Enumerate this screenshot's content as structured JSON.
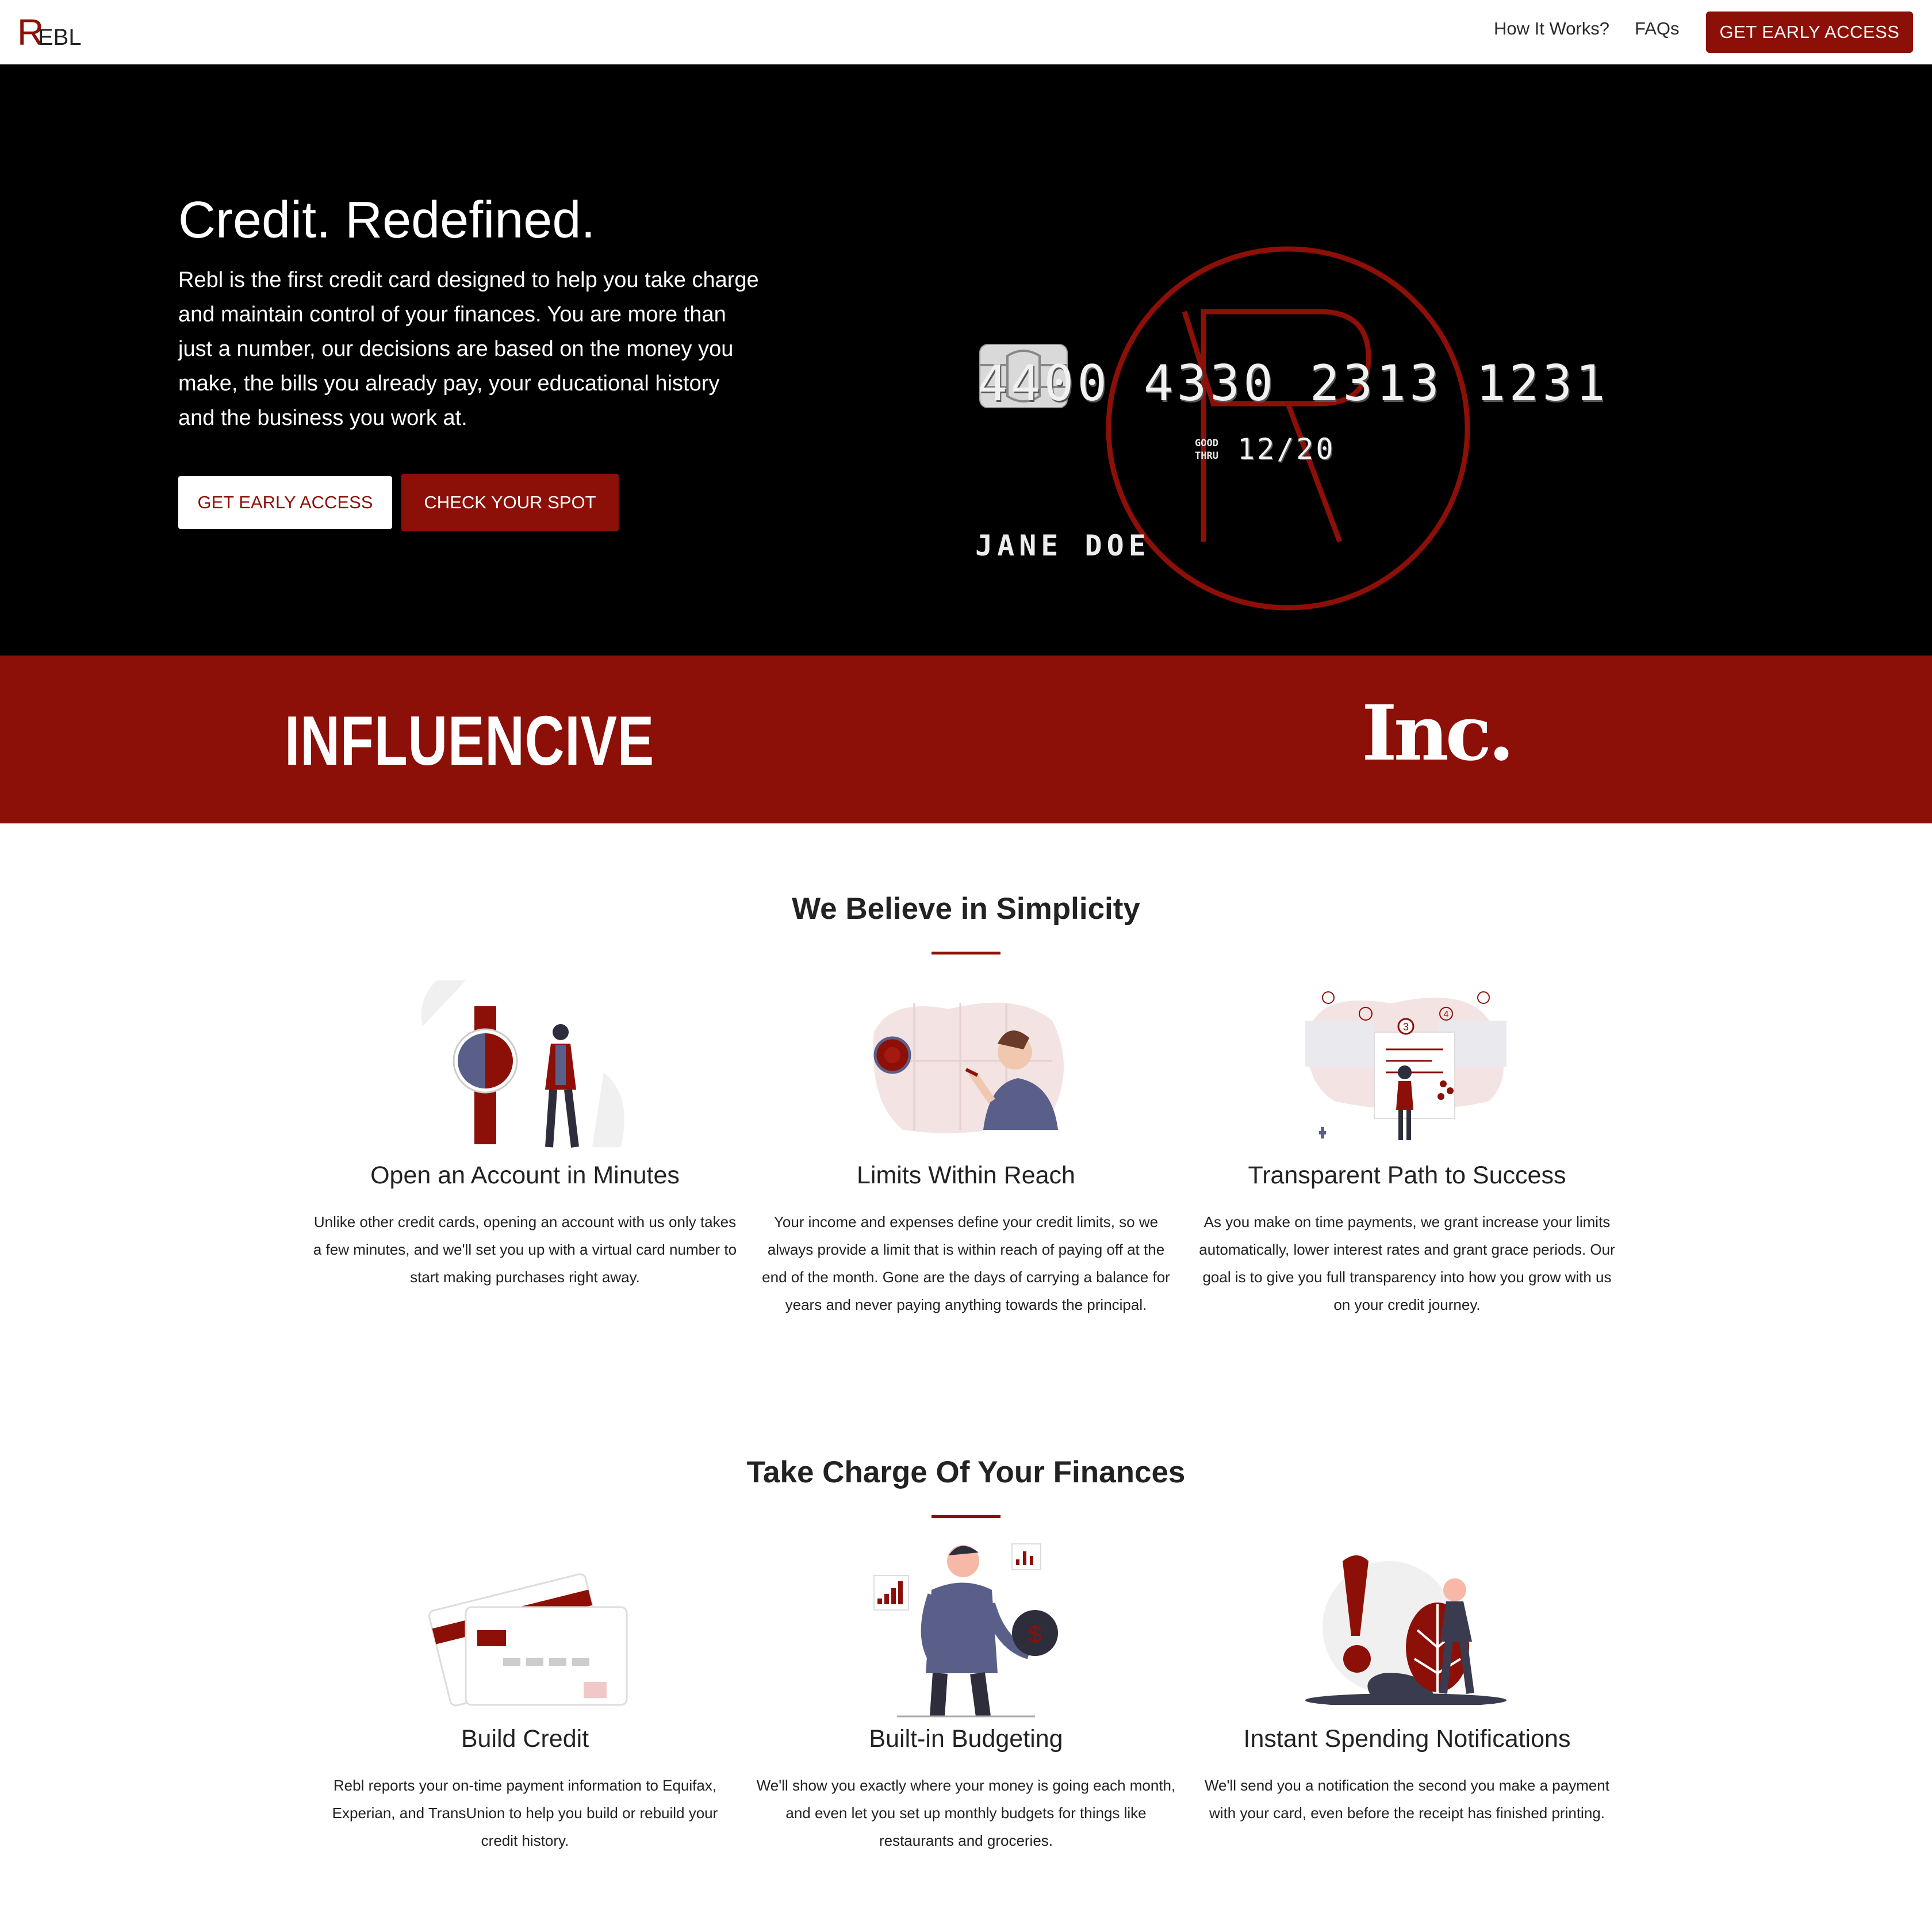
{
  "colors": {
    "accent": "#8c1007",
    "hero_bg": "#000000",
    "text": "#222222"
  },
  "nav": {
    "logo_letter": "R",
    "logo_text": "EBL",
    "links": [
      "How It Works?",
      "FAQs"
    ],
    "cta": "GET EARLY ACCESS"
  },
  "hero": {
    "title": "Credit. Redefined.",
    "text": "Rebl is the first credit card designed to help you take charge and maintain control of your finances. You are more than just a number, our decisions are based on the money you make, the bills you already pay, your educational history and the business you work at.",
    "primary_button": "GET EARLY ACCESS",
    "secondary_button": "CHECK YOUR SPOT",
    "card": {
      "number": "4400 4330 2313 1231",
      "good_thru_label_1": "GOOD",
      "good_thru_label_2": "THRU",
      "expiry": "12/20",
      "name": "JANE DOE"
    }
  },
  "press": [
    "INFLUENCIVE",
    "Inc."
  ],
  "simplicity": {
    "title": "We Believe in Simplicity",
    "features": [
      {
        "title": "Open an Account in Minutes",
        "text": "Unlike other credit cards, opening an account with us only takes a few minutes, and we'll set you up with a virtual card number to start making purchases right away.",
        "icon": "watch-person-illustration"
      },
      {
        "title": "Limits Within Reach",
        "text": "Your income and expenses define your credit limits, so we always provide a limit that is within reach of paying off at the end of the month. Gone are the days of carrying a balance for years and never paying anything towards the principal.",
        "icon": "dartboard-illustration"
      },
      {
        "title": "Transparent Path to Success",
        "text": "As you make on time payments, we grant increase your limits automatically, lower interest rates and grant grace periods. Our goal is to give you full transparency into how you grow with us on your credit journey.",
        "icon": "progress-steps-illustration",
        "steps": [
          "3",
          "4"
        ]
      }
    ]
  },
  "finances": {
    "title": "Take Charge Of Your Finances",
    "features": [
      {
        "title": "Build Credit",
        "text": "Rebl reports your on-time payment information to Equifax, Experian, and TransUnion to help you build or rebuild your credit history.",
        "icon": "credit-cards-illustration"
      },
      {
        "title": "Built-in Budgeting",
        "text": "We'll show you exactly where your money is going each month, and even let you set up monthly budgets for things like restaurants and groceries.",
        "icon": "budget-person-illustration",
        "coin_symbol": "$"
      },
      {
        "title": "Instant Spending Notifications",
        "text": "We'll send you a notification the second you make a payment with your card, even before the receipt has finished printing.",
        "icon": "exclamation-illustration"
      }
    ]
  }
}
